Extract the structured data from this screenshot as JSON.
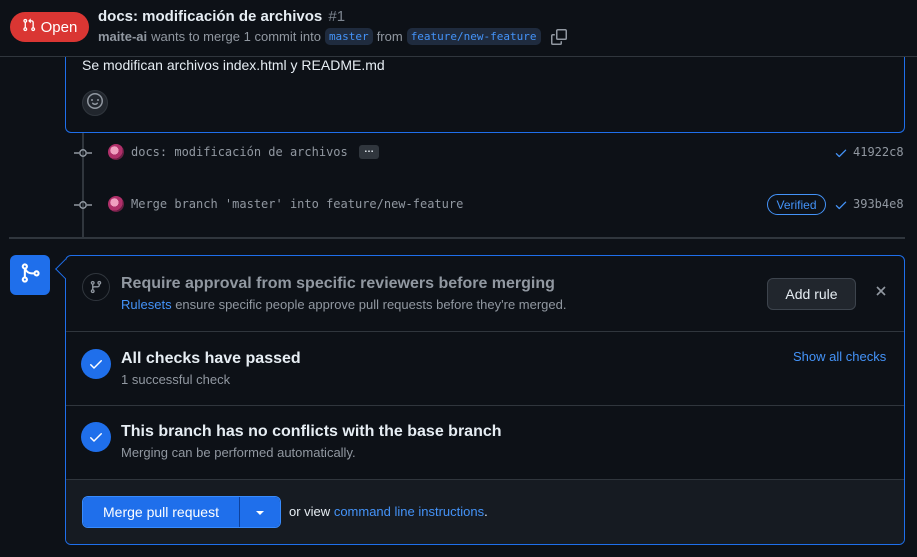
{
  "header": {
    "state_label": "Open",
    "title": "docs: modificación de archivos",
    "number": "#1",
    "author": "maite-ai",
    "merge_text": "wants to merge 1 commit into",
    "base_branch": "master",
    "from_text": "from",
    "head_branch": "feature/new-feature"
  },
  "description": {
    "text": "Se modifican archivos index.html y README.md"
  },
  "commits": [
    {
      "message": "docs: modificación de archivos",
      "has_ellipsis": true,
      "ellipsis": "…",
      "sha": "41922c8",
      "verified": ""
    },
    {
      "message": "Merge branch 'master' into feature/new-feature",
      "has_ellipsis": false,
      "sha": "393b4e8",
      "verified": "Verified"
    }
  ],
  "merge_box": {
    "rule": {
      "title": "Require approval from specific reviewers before merging",
      "link_text": "Rulesets",
      "desc_rest": "ensure specific people approve pull requests before they're merged.",
      "add_rule_label": "Add rule"
    },
    "checks": {
      "title": "All checks have passed",
      "subtitle": "1 successful check",
      "show_all_label": "Show all checks"
    },
    "conflicts": {
      "title": "This branch has no conflicts with the base branch",
      "subtitle": "Merging can be performed automatically."
    },
    "footer": {
      "merge_button_label": "Merge pull request",
      "or_view_text": "or view",
      "cli_link_text": "command line instructions",
      "period": "."
    }
  },
  "colors": {
    "open_badge": "#da3633",
    "accent_blue": "#1f6feb",
    "link_blue": "#4493f8",
    "background": "#0d1117"
  }
}
